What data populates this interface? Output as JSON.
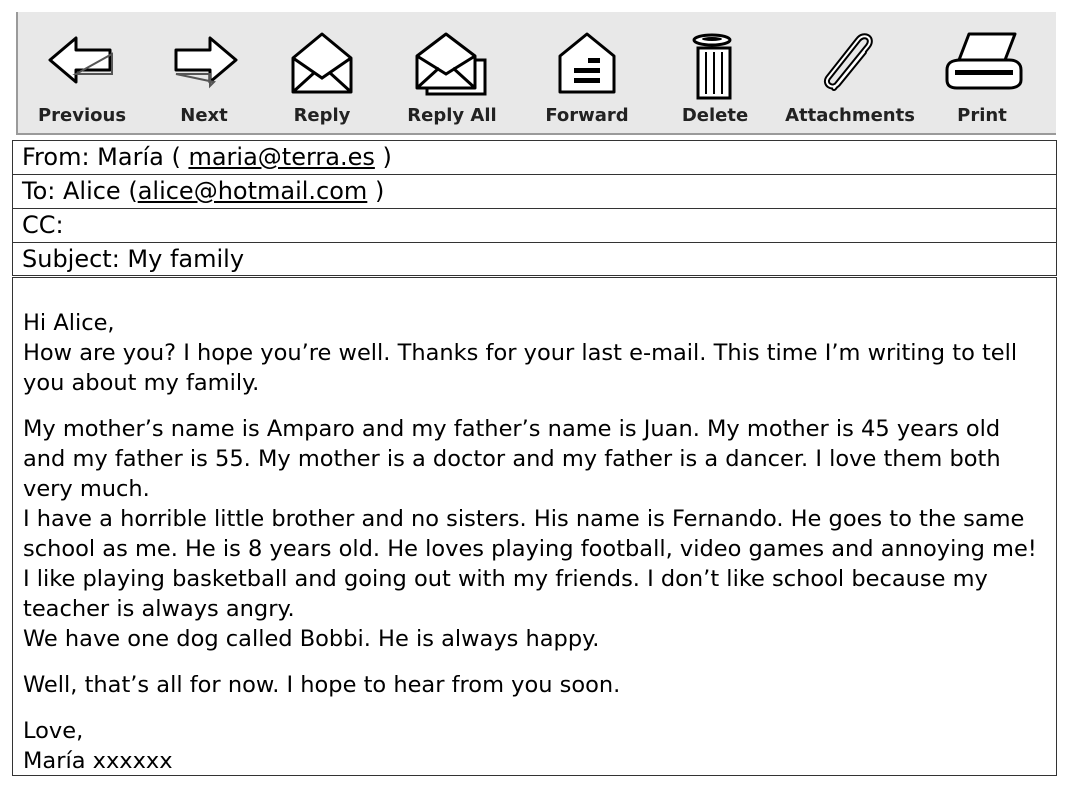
{
  "toolbar": {
    "buttons": [
      {
        "label": "Previous",
        "icon": "arrow-left-icon"
      },
      {
        "label": "Next",
        "icon": "arrow-right-icon"
      },
      {
        "label": "Reply",
        "icon": "open-envelope-icon"
      },
      {
        "label": "Reply All",
        "icon": "stacked-envelopes-icon"
      },
      {
        "label": "Forward",
        "icon": "forward-envelope-icon"
      },
      {
        "label": "Delete",
        "icon": "trash-can-icon"
      },
      {
        "label": "Attachments",
        "icon": "paperclip-icon"
      },
      {
        "label": "Print",
        "icon": "printer-icon"
      }
    ]
  },
  "header": {
    "from_label": "From: María ( ",
    "from_email": "maria@terra.es",
    "from_suffix": " )",
    "to_label": "To: Alice (",
    "to_email": "alice@hotmail.com",
    "to_suffix": " )",
    "cc_label": "CC:",
    "subject_label": "Subject: My family"
  },
  "message": {
    "greeting": "Hi Alice,",
    "paragraph1": "How are you? I hope you’re well. Thanks for your last e-mail. This time I’m writing to tell you about my family.",
    "paragraph2": "My mother’s name is Amparo and my father’s name is Juan. My mother is 45 years old and my father is 55. My mother is a doctor and my father is a dancer. I love them both very much.",
    "paragraph3": "I have a horrible little brother and no sisters. His name is Fernando. He goes to the same school as me. He is 8 years old. He loves playing football, video games and annoying me! I like playing basketball and going out with my friends. I don’t like school because my teacher is always angry.",
    "paragraph4": "We have one dog called Bobbi. He is always happy.",
    "paragraph5": "Well, that’s all for now. I hope to hear from you soon.",
    "closing": "Love,",
    "signature": "María xxxxxx"
  }
}
